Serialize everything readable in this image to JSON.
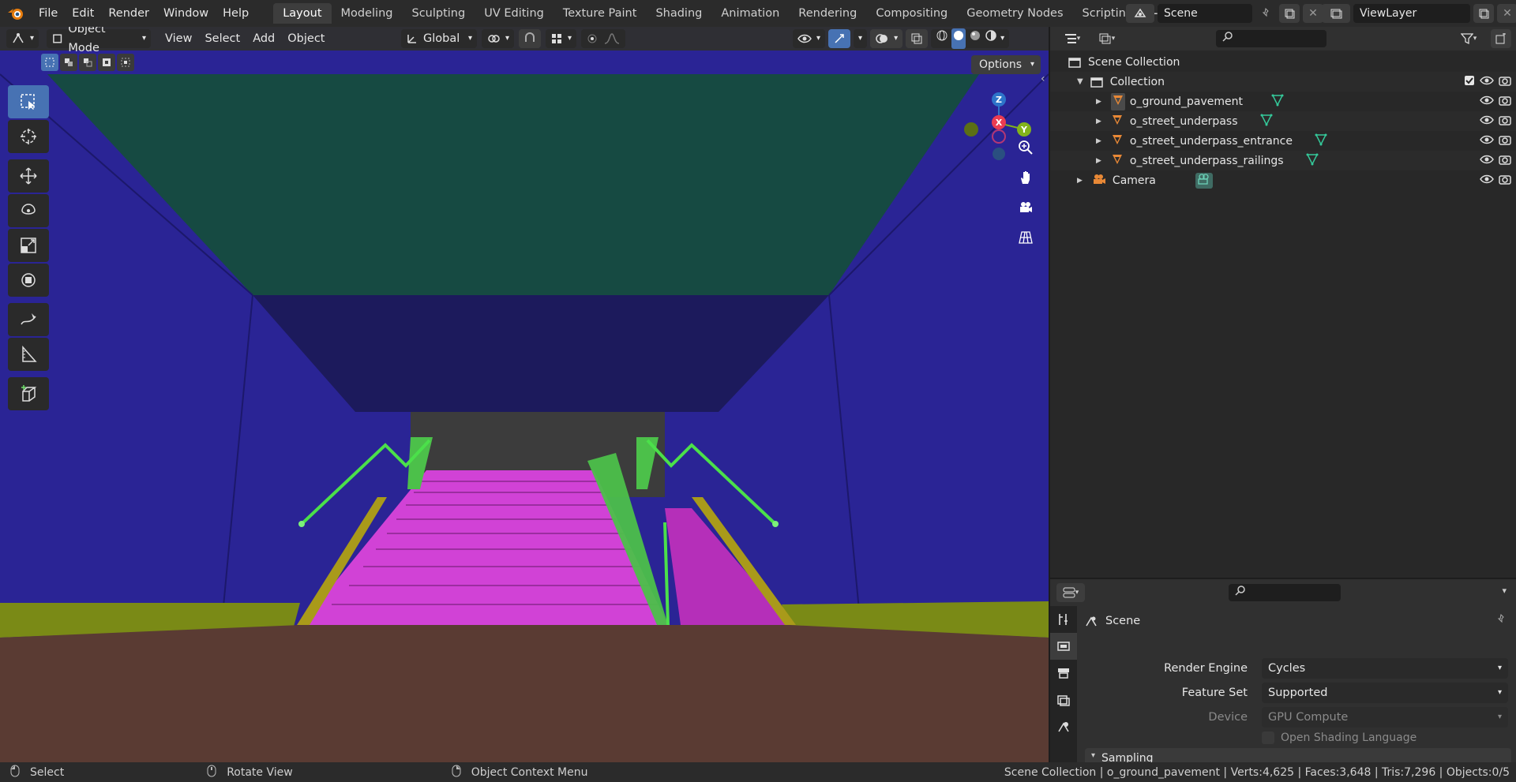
{
  "menu": [
    "File",
    "Edit",
    "Render",
    "Window",
    "Help"
  ],
  "workspaces": [
    "Layout",
    "Modeling",
    "Sculpting",
    "UV Editing",
    "Texture Paint",
    "Shading",
    "Animation",
    "Rendering",
    "Compositing",
    "Geometry Nodes",
    "Scripting"
  ],
  "active_workspace": "Layout",
  "scene_name": "Scene",
  "view_layer": "ViewLayer",
  "viewport_header": {
    "mode": "Object Mode",
    "menus": [
      "View",
      "Select",
      "Add",
      "Object"
    ],
    "orientation": "Global",
    "options": "Options"
  },
  "gizmo_axes": {
    "z": "Z",
    "x": "X",
    "y": "Y"
  },
  "outliner": {
    "root": "Scene Collection",
    "collection": "Collection",
    "objects": [
      "o_ground_pavement",
      "o_street_underpass",
      "o_street_underpass_entrance",
      "o_street_underpass_railings"
    ],
    "camera": "Camera"
  },
  "properties": {
    "context": "Scene",
    "render_engine_label": "Render Engine",
    "render_engine": "Cycles",
    "feature_set_label": "Feature Set",
    "feature_set": "Supported",
    "device_label": "Device",
    "device": "GPU Compute",
    "osl": "Open Shading Language",
    "sampling": "Sampling"
  },
  "status": {
    "select": "Select",
    "rotate": "Rotate View",
    "context_menu": "Object Context Menu",
    "stats": "Scene Collection | o_ground_pavement | Verts:4,625 | Faces:3,648 | Tris:7,296 | Objects:0/5"
  },
  "colors": {
    "accent": "#4772b3",
    "wall": "#2a2495",
    "ceiling": "#164a42",
    "stairs": "#d142d6",
    "railing": "#39c43b",
    "floor": "#5a3b33",
    "trim": "#7a8a16"
  }
}
